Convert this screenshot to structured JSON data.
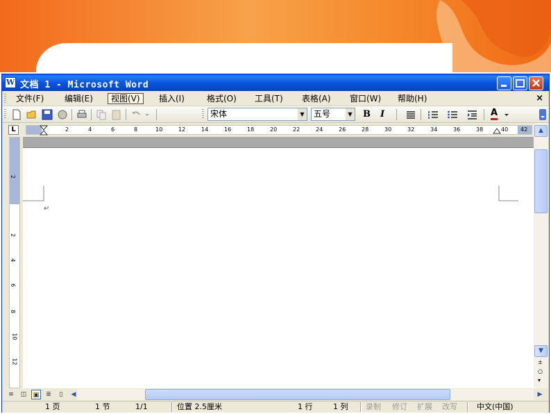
{
  "window": {
    "title": "文档 1 - Microsoft Word",
    "app_icon_glyph": "W"
  },
  "menu": {
    "items": [
      "文件(F)",
      "编辑(E)",
      "视图(V)",
      "插入(I)",
      "格式(O)",
      "工具(T)",
      "表格(A)",
      "窗口(W)",
      "帮助(H)"
    ],
    "active_item": "视图(V)",
    "close_glyph": "×"
  },
  "toolbar": {
    "font_name": "宋体",
    "font_size": "五号",
    "bold_label": "B",
    "italic_label": "I",
    "font_color_label": "A"
  },
  "ruler": {
    "corner_glyph": "L",
    "h_numbers": [
      "2",
      "4",
      "6",
      "8",
      "10",
      "12",
      "14",
      "16",
      "18",
      "20",
      "22",
      "24",
      "26",
      "28",
      "30",
      "32",
      "34",
      "36",
      "38",
      "40",
      "42"
    ],
    "v_numbers": [
      "2",
      "2",
      "4",
      "6",
      "8",
      "10",
      "12"
    ]
  },
  "document": {
    "paragraph_mark": "↵"
  },
  "status": {
    "page": "1 页",
    "section": "1 节",
    "page_of": "1/1",
    "position": "位置 2.5厘米",
    "line": "1 行",
    "column": "1 列",
    "rec": "录制",
    "trk": "修订",
    "ext": "扩展",
    "ovr": "改写",
    "language": "中文(中国)"
  },
  "colors": {
    "banner_orange": "#f26a1b",
    "titlebar_blue": "#0a56de",
    "chrome": "#ece9d8",
    "font_color_red": "#e01010"
  }
}
